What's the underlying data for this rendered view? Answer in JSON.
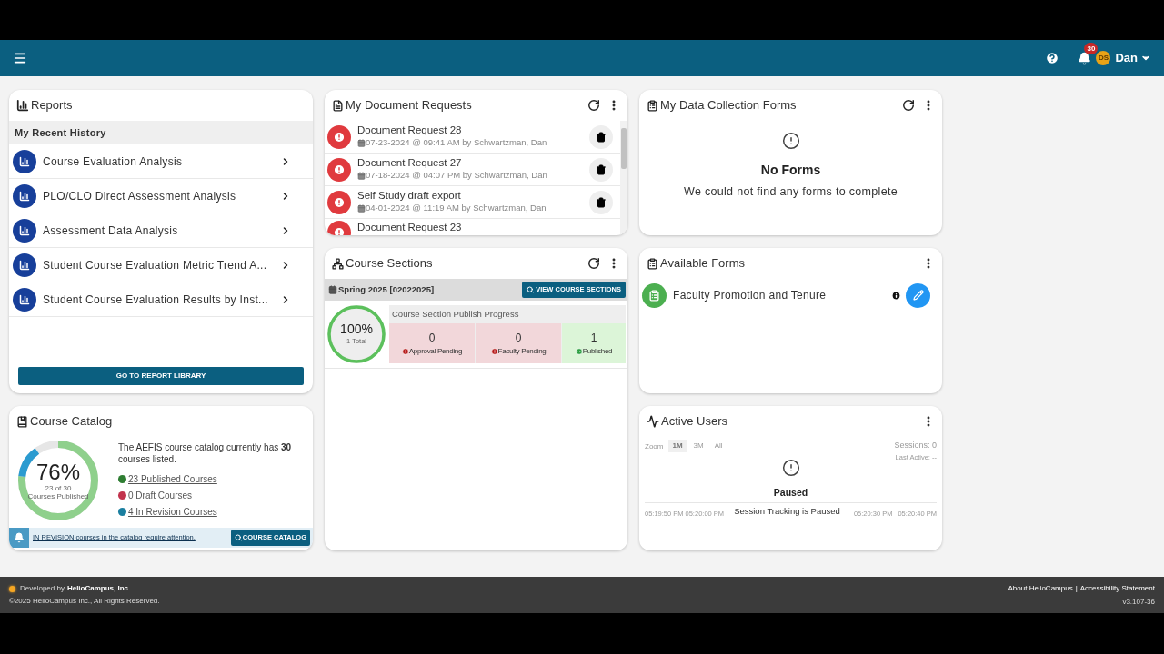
{
  "header": {
    "notification_count": "30",
    "avatar_initials": "DS",
    "user_name": "Dan"
  },
  "reports": {
    "title": "Reports",
    "section": "My Recent History",
    "items": [
      {
        "label": "Course Evaluation Analysis"
      },
      {
        "label": "PLO/CLO Direct Assessment Analysis"
      },
      {
        "label": "Assessment Data Analysis"
      },
      {
        "label": "Student Course Evaluation Metric Trend A..."
      },
      {
        "label": "Student Course Evaluation Results by Inst..."
      }
    ],
    "button": "GO TO REPORT LIBRARY"
  },
  "course_catalog": {
    "title": "Course Catalog",
    "percent": "76%",
    "sub1": "23 of 30",
    "sub2": "Courses Published",
    "description": "The AEFIS course catalog currently has **30** courses listed.",
    "legend": [
      {
        "label": "23 Published Courses",
        "color": "#2e7d32",
        "level": 0.767
      },
      {
        "label": "0 Draft Courses",
        "color": "#c2334d",
        "level": 0
      },
      {
        "label": "4 In Revision Courses",
        "color": "#1b7fa0",
        "level": 0.133
      }
    ],
    "alert": "IN REVISION courses in the catalog require attention.",
    "button": "COURSE CATALOG"
  },
  "document_requests": {
    "title": "My Document Requests",
    "items": [
      {
        "title": "Document Request 28",
        "meta": "07-23-2024 @ 09:41 AM by Schwartzman, Dan"
      },
      {
        "title": "Document Request 27",
        "meta": "07-18-2024 @ 04:07 PM by Schwartzman, Dan"
      },
      {
        "title": "Self Study draft export",
        "meta": "04-01-2024 @ 11:19 AM by Schwartzman, Dan"
      },
      {
        "title": "Document Request 23"
      }
    ]
  },
  "course_sections": {
    "title": "Course Sections",
    "term": "Spring 2025 [02022025]",
    "button": "VIEW COURSE SECTIONS",
    "percent": "100%",
    "total": "1 Total",
    "level": 1,
    "progress_title": "Course Section Publish Progress",
    "stages": [
      {
        "count": "0",
        "label": "Approval Pending",
        "kind": "pending"
      },
      {
        "count": "0",
        "label": "Faculty Pending",
        "kind": "pending"
      },
      {
        "count": "1",
        "label": "Published",
        "kind": "done"
      }
    ]
  },
  "data_collection_forms": {
    "title": "My Data Collection Forms",
    "empty_title": "No Forms",
    "empty_text": "We could not find any forms to complete"
  },
  "available_forms": {
    "title": "Available Forms",
    "items": [
      {
        "label": "Faculty Promotion and Tenure"
      }
    ]
  },
  "active_users": {
    "title": "Active Users",
    "zoom_label": "Zoom",
    "zoom_options": [
      {
        "label": "1M",
        "selected": true
      },
      {
        "label": "3M",
        "selected": false
      },
      {
        "label": "All",
        "selected": false
      }
    ],
    "sessions": "Sessions: 0",
    "last_active": "Last Active: --",
    "ticks_left": [
      "05:19:50 PM",
      "05:20:00 PM"
    ],
    "ticks_right": [
      "05:20:30 PM",
      "05:20:40 PM"
    ],
    "status_title": "Paused",
    "status_text": "Session Tracking is Paused"
  },
  "footer": {
    "developed_by": "Developed by",
    "company": "HelioCampus, Inc.",
    "copyright": "©2025 HelioCampus Inc., All Rights Reserved.",
    "links": [
      "About HelioCampus",
      "Accessibility Statement"
    ],
    "separator": "|",
    "version": "v3.107-36"
  }
}
